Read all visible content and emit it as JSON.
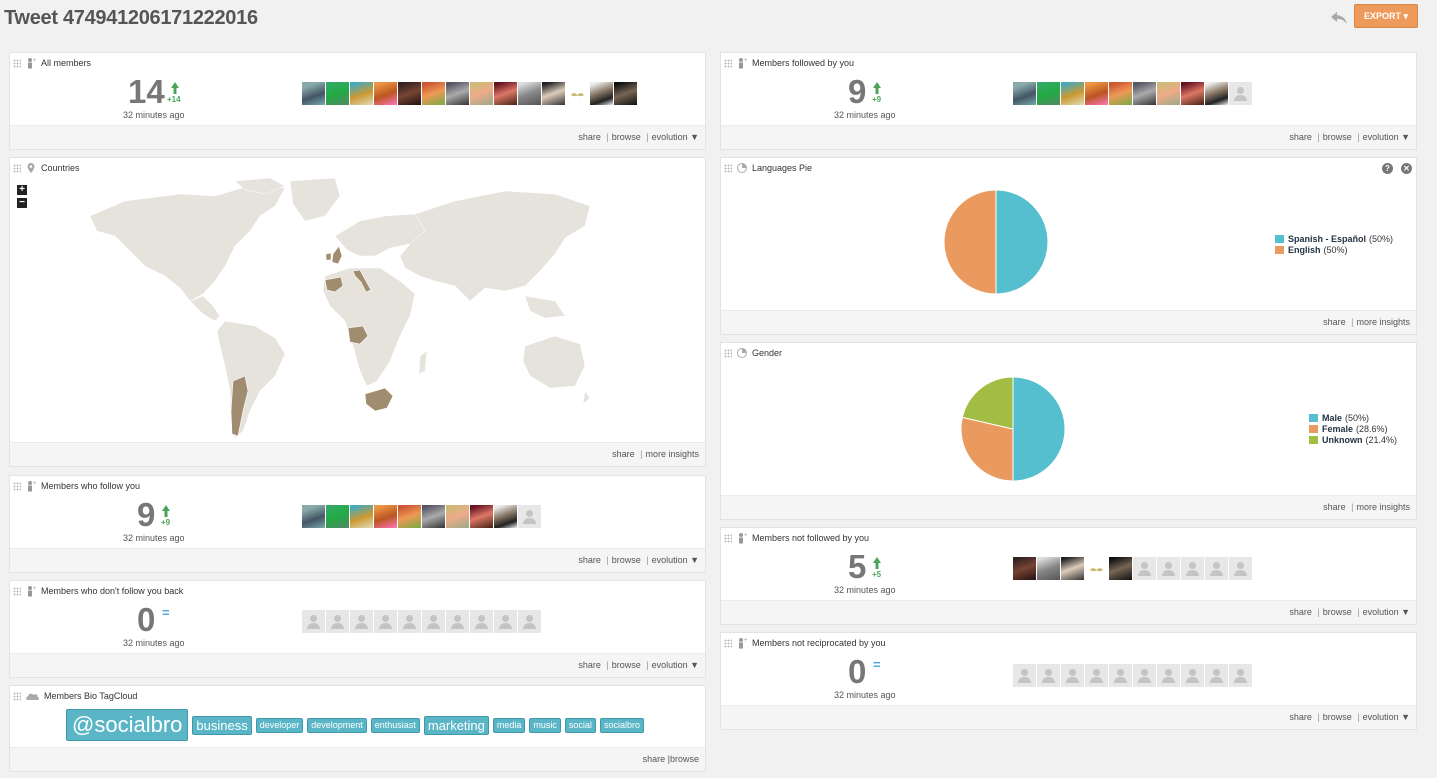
{
  "header": {
    "title": "Tweet 474941206171222016",
    "export_label": "EXPORT"
  },
  "colors": {
    "accent": "#ee9a5b",
    "blue": "#56bfcf",
    "orange": "#ea9a5e",
    "green": "#a1bd44",
    "map_highlight": "#a08c6e",
    "map_land": "#e6e3dd"
  },
  "panels": {
    "all_members": {
      "title": "All members",
      "count": "14",
      "delta": "+14",
      "ago": "32 minutes ago"
    },
    "followed_by_you": {
      "title": "Members followed by you",
      "count": "9",
      "delta": "+9",
      "ago": "32 minutes ago"
    },
    "countries": {
      "title": "Countries",
      "zoom_in": "+",
      "zoom_out": "−"
    },
    "languages": {
      "title": "Languages Pie",
      "help": "?",
      "close": "✕"
    },
    "gender": {
      "title": "Gender"
    },
    "follow_you": {
      "title": "Members who follow you",
      "count": "9",
      "delta": "+9",
      "ago": "32 minutes ago"
    },
    "not_follow_back": {
      "title": "Members who don't follow you back",
      "count": "0",
      "delta": "=",
      "ago": "32 minutes ago"
    },
    "not_followed": {
      "title": "Members not followed by you",
      "count": "5",
      "delta": "+5",
      "ago": "32 minutes ago"
    },
    "not_reciprocated": {
      "title": "Members not reciprocated by you",
      "count": "0",
      "delta": "=",
      "ago": "32 minutes ago"
    },
    "tagcloud": {
      "title": "Members Bio TagCloud"
    }
  },
  "footer_links": {
    "share": "share",
    "browse": "browse",
    "evolution": "evolution ▼",
    "more_insights": "more insights",
    "share_browse": "share |browse",
    "sep": "|"
  },
  "chart_data": [
    {
      "type": "pie",
      "title": "Languages Pie",
      "categories": [
        "Spanish - Español",
        "English"
      ],
      "values": [
        50,
        50
      ],
      "colors": [
        "#56bfcf",
        "#ea9a5e"
      ],
      "legend_labels": [
        "(50%)",
        "(50%)"
      ],
      "legend": "right"
    },
    {
      "type": "pie",
      "title": "Gender",
      "categories": [
        "Male",
        "Female",
        "Unknown"
      ],
      "values": [
        50,
        28.6,
        21.4
      ],
      "colors": [
        "#56bfcf",
        "#ea9a5e",
        "#a1bd44"
      ],
      "legend_labels": [
        "(50%)",
        "(28.6%)",
        "(21.4%)"
      ],
      "legend": "right"
    }
  ],
  "tags": [
    {
      "text": "@socialbro",
      "size": 22
    },
    {
      "text": "business",
      "size": 13
    },
    {
      "text": "developer",
      "size": 9
    },
    {
      "text": "development",
      "size": 9
    },
    {
      "text": "enthusiast",
      "size": 9
    },
    {
      "text": "marketing",
      "size": 13
    },
    {
      "text": "media",
      "size": 9
    },
    {
      "text": "music",
      "size": 9
    },
    {
      "text": "social",
      "size": 9
    },
    {
      "text": "socialbro",
      "size": 9
    }
  ]
}
